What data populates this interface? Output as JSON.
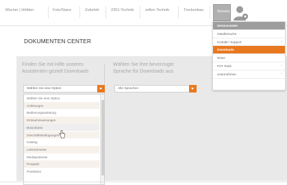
{
  "nav": {
    "items": [
      "Mücher | Höfden",
      "Foto/Stanz",
      "Zubehör",
      "2301-Technik",
      "zellen Technik",
      "Trockenbau"
    ],
    "active": "Service"
  },
  "page": {
    "title": "DOKUMENTEN CENTER"
  },
  "panel1": {
    "text": [
      "Finden Sie mit Hilfe unseres",
      "Assistenten gezielt Downloads"
    ]
  },
  "panel2": {
    "text": [
      "Wählen Sie Ihre bevorzugte",
      "Sprache für Downloads aus"
    ]
  },
  "select1": {
    "value": "Wählen Sie eine Option"
  },
  "select2": {
    "value": "Alle Sprachen"
  },
  "options": [
    "Wählen Sie eine Option",
    "Anleitungen",
    "Bedienungsanleitung",
    "Einbauhinweisungen",
    "Broschüren",
    "Geschäftsbedingungen",
    "Katalog",
    "Leitsortimente",
    "Mediapräsente",
    "Prospekt",
    "Preislisten"
  ],
  "dropdown": {
    "header": "Servicecenter",
    "items": [
      {
        "label": "Händlersuche",
        "chevron": false
      },
      {
        "label": "Kontakt / Support",
        "chevron": true
      },
      {
        "label": "Downloads",
        "chevron": false,
        "active": true
      },
      {
        "label": "News",
        "chevron": false
      },
      {
        "label": "PVT Tools",
        "chevron": true
      },
      {
        "label": "Unternehmen",
        "chevron": true
      }
    ]
  },
  "colors": {
    "accent": "#e8781e",
    "band": "#e9e9e9",
    "menu_header": "#9d9d9d"
  },
  "icons": {
    "avatar": "user-avatar-icon",
    "dropdown_button": "chevron-down-icon",
    "cursor": "hand-cursor-icon"
  }
}
